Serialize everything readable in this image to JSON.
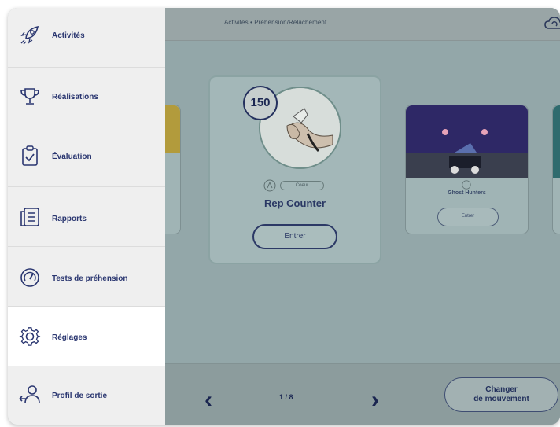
{
  "breadcrumb": "Activités • Préhension/Relâchement",
  "sidebar": {
    "items": [
      {
        "label": "Activités",
        "icon": "rocket-icon",
        "active": false
      },
      {
        "label": "Réalisations",
        "icon": "trophy-icon",
        "active": false
      },
      {
        "label": "Évaluation",
        "icon": "clipboard-check-icon",
        "active": false
      },
      {
        "label": "Rapports",
        "icon": "report-icon",
        "active": false
      },
      {
        "label": "Tests de préhension",
        "icon": "gauge-icon",
        "active": false
      },
      {
        "label": "Réglages",
        "icon": "gear-icon",
        "active": true
      },
      {
        "label": "Profil de sortie",
        "icon": "logout-profile-icon",
        "active": false
      }
    ]
  },
  "carousel": {
    "main_card": {
      "badge": "150",
      "tag": "Coeur",
      "title": "Rep Counter",
      "button": "Entrer"
    },
    "right_card": {
      "title": "Ghost Hunters",
      "button": "Entrer"
    }
  },
  "footer": {
    "prev_icon": "chevron-left-icon",
    "next_icon": "chevron-right-icon",
    "page_indicator": "1 / 8",
    "change_button_line1": "Changer",
    "change_button_line2": "de mouvement"
  },
  "colors": {
    "sidebar_text": "#2a3670",
    "overlay": "#93a7a9",
    "active_item": "#ffffff"
  }
}
